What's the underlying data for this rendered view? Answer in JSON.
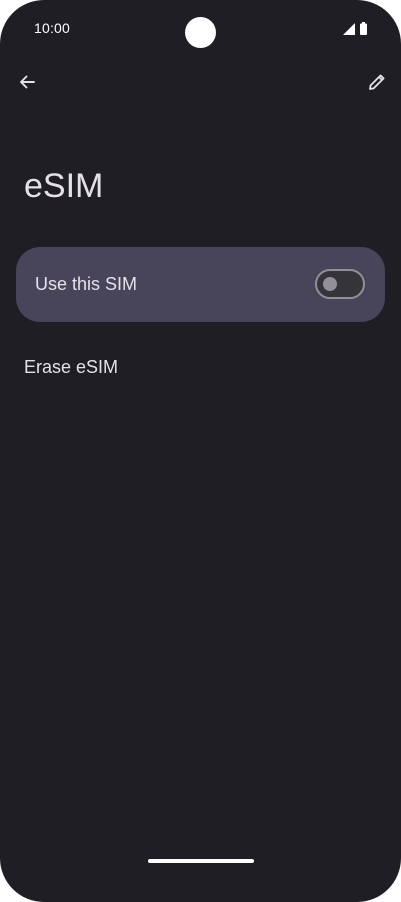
{
  "status_bar": {
    "time": "10:00",
    "icons": [
      "signal-icon",
      "battery-icon"
    ]
  },
  "toolbar": {
    "back_icon": "arrow-back-icon",
    "edit_icon": "pencil-icon"
  },
  "page": {
    "title": "eSIM"
  },
  "sim_toggle": {
    "label": "Use this SIM",
    "checked": false
  },
  "actions": {
    "erase_label": "Erase eSIM"
  },
  "colors": {
    "background": "#1f1e25",
    "card": "#48445a",
    "text": "#e6e1e9",
    "toggle_outline": "#938f99"
  }
}
